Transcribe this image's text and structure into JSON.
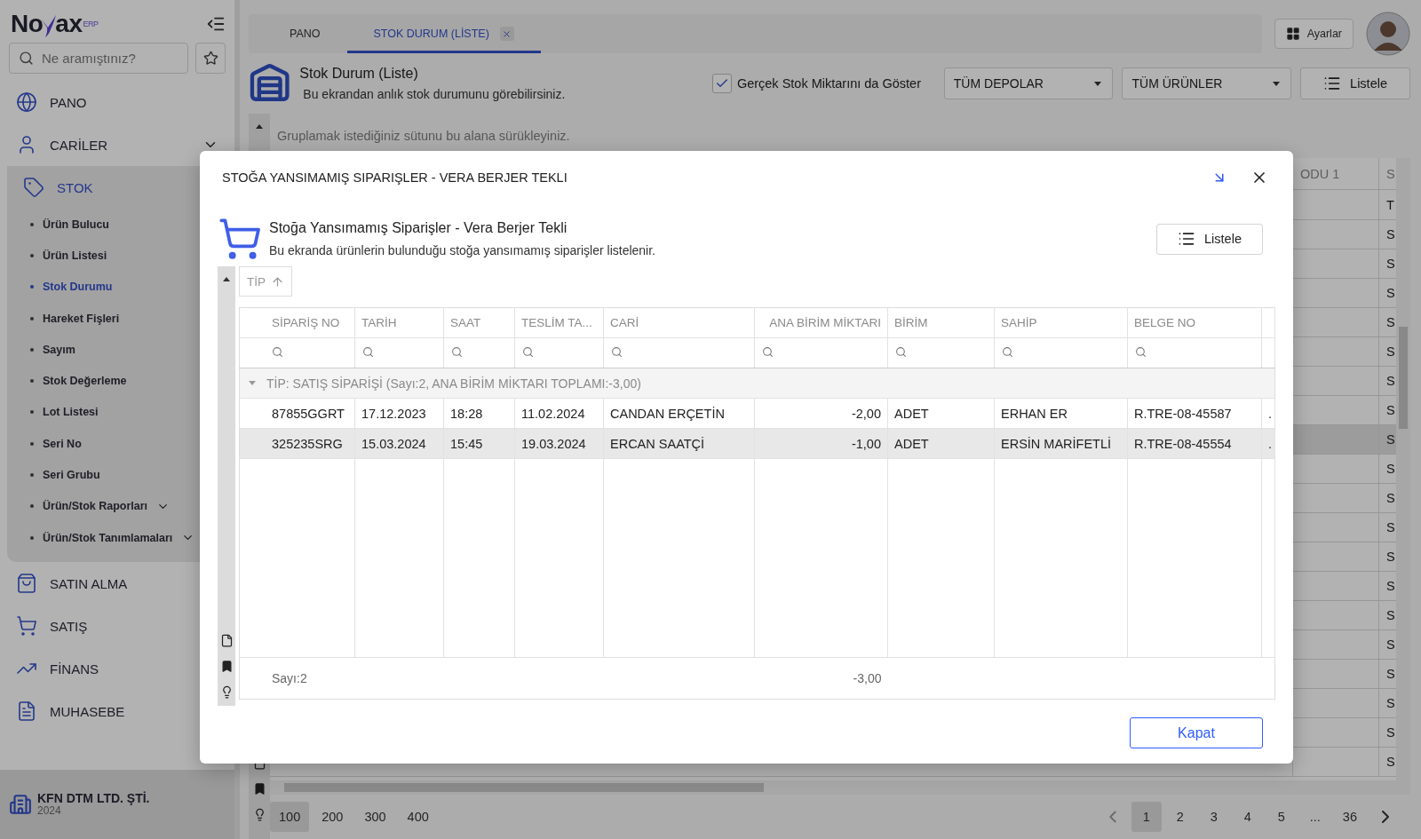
{
  "sidebar": {
    "logo": {
      "left": "No",
      "right": "ax",
      "suffix": "ERP"
    },
    "search": {
      "placeholder": "Ne aramıştınız?"
    },
    "items": [
      {
        "label": "PANO",
        "selected": false
      },
      {
        "label": "CARİLER",
        "selected": false,
        "expanded": false
      },
      {
        "label": "STOK",
        "selected": true,
        "expanded": true,
        "children": [
          {
            "label": "Ürün Bulucu",
            "selected": false
          },
          {
            "label": "Ürün Listesi",
            "selected": false
          },
          {
            "label": "Stok Durumu",
            "selected": true
          },
          {
            "label": "Hareket Fişleri",
            "selected": false
          },
          {
            "label": "Sayım",
            "selected": false
          },
          {
            "label": "Stok Değerleme",
            "selected": false
          },
          {
            "label": "Lot Listesi",
            "selected": false
          },
          {
            "label": "Seri No",
            "selected": false
          },
          {
            "label": "Seri Grubu",
            "selected": false
          },
          {
            "label": "Ürün/Stok Raporları",
            "selected": false,
            "expanded": false
          },
          {
            "label": "Ürün/Stok Tanımlamaları",
            "selected": false,
            "expanded": false
          }
        ]
      },
      {
        "label": "SATIN ALMA",
        "selected": false
      },
      {
        "label": "SATIŞ",
        "selected": false
      },
      {
        "label": "FİNANS",
        "selected": false
      },
      {
        "label": "MUHASEBE",
        "selected": false
      }
    ],
    "company": {
      "name": "KFN DTM LTD. ŞTİ.",
      "year": "2024"
    }
  },
  "tabs": [
    {
      "label": "PANO",
      "selected": false,
      "closable": false
    },
    {
      "label": "STOK DURUM (LİSTE)",
      "selected": true,
      "closable": true
    }
  ],
  "settings_button": "Ayarlar",
  "page": {
    "title": "Stok Durum (Liste)",
    "subtitle": "Bu ekrandan anlık stok durumunu görebilirsiniz.",
    "real_stock": {
      "label": "Gerçek Stok Miktarını da Göster",
      "checked": true
    },
    "warehouse_select": "TÜM DEPOLAR",
    "product_select": "TÜM ÜRÜNLER",
    "list_button": "Listele"
  },
  "grid": {
    "group_hint": "Gruplamak istediğiniz sütunu bu alana sürükleyiniz.",
    "columns": [
      "ODU 1",
      "S"
    ],
    "filter": "T",
    "rows": [
      {
        "cell": "S",
        "selected": false
      },
      {
        "cell": "S",
        "selected": false
      },
      {
        "cell": "S",
        "selected": false
      },
      {
        "cell": "S",
        "selected": false
      },
      {
        "cell": "S",
        "selected": false
      },
      {
        "cell": "S",
        "selected": false
      },
      {
        "cell": "S",
        "selected": false
      },
      {
        "cell": "S",
        "selected": true
      },
      {
        "cell": "S",
        "selected": false
      },
      {
        "cell": "S",
        "selected": false
      },
      {
        "cell": "S",
        "selected": false
      },
      {
        "cell": "S",
        "selected": false
      },
      {
        "cell": "S",
        "selected": false
      },
      {
        "cell": "S",
        "selected": false
      },
      {
        "cell": "S",
        "selected": false
      },
      {
        "cell": "S",
        "selected": false
      },
      {
        "cell": "S",
        "selected": false
      },
      {
        "cell": "S",
        "selected": false
      },
      {
        "cell": "S",
        "selected": false
      }
    ],
    "page_sizes": [
      {
        "label": "100",
        "selected": true
      },
      {
        "label": "200",
        "selected": false
      },
      {
        "label": "300",
        "selected": false
      },
      {
        "label": "400",
        "selected": false
      }
    ],
    "pages": [
      {
        "label": "1",
        "selected": true
      },
      {
        "label": "2",
        "selected": false
      },
      {
        "label": "3",
        "selected": false
      },
      {
        "label": "4",
        "selected": false
      },
      {
        "label": "5",
        "selected": false
      },
      {
        "label": "...",
        "selected": false
      },
      {
        "label": "36",
        "selected": false
      }
    ]
  },
  "modal": {
    "title": "STOĞA YANSIMAMIŞ SIPARIŞLER - VERA BERJER TEKLI",
    "heading": "Stoğa Yansımamış Siparişler - Vera Berjer Tekli",
    "subtitle": "Bu ekranda ürünlerin bulunduğu stoğa yansımamış siparişler listelenir.",
    "list_button": "Listele",
    "group_chip": "TİP",
    "columns": [
      {
        "label": "SİPARİŞ NO",
        "kind": "text"
      },
      {
        "label": "TARİH",
        "kind": "text"
      },
      {
        "label": "SAAT",
        "kind": "text"
      },
      {
        "label": "TESLİM TA...",
        "kind": "text"
      },
      {
        "label": "CARİ",
        "kind": "text"
      },
      {
        "label": "ANA BİRİM MİKTARI",
        "kind": "number"
      },
      {
        "label": "BİRİM",
        "kind": "text"
      },
      {
        "label": "SAHİP",
        "kind": "text"
      },
      {
        "label": "BELGE NO",
        "kind": "text"
      }
    ],
    "group": {
      "label": "TİP: SATIŞ SİPARİŞİ (Sayı:2, ANA BİRİM MİKTARI TOPLAMI:-3,00)",
      "expanded": true
    },
    "rows": [
      {
        "cells": [
          "87855GGRT",
          "17.12.2023",
          "18:28",
          "11.02.2024",
          "CANDAN ERÇETİN",
          "-2,00",
          "ADET",
          "ERHAN ER",
          "R.TRE-08-45587",
          "."
        ],
        "selected": false
      },
      {
        "cells": [
          "325235SRG",
          "15.03.2024",
          "15:45",
          "19.03.2024",
          "ERCAN SAATÇİ",
          "-1,00",
          "ADET",
          "ERSİN MARİFETLİ",
          "R.TRE-08-45554",
          "."
        ],
        "selected": true
      }
    ],
    "footer": {
      "count": "Sayı:2",
      "total": "-3,00"
    },
    "close_button": "Kapat"
  }
}
